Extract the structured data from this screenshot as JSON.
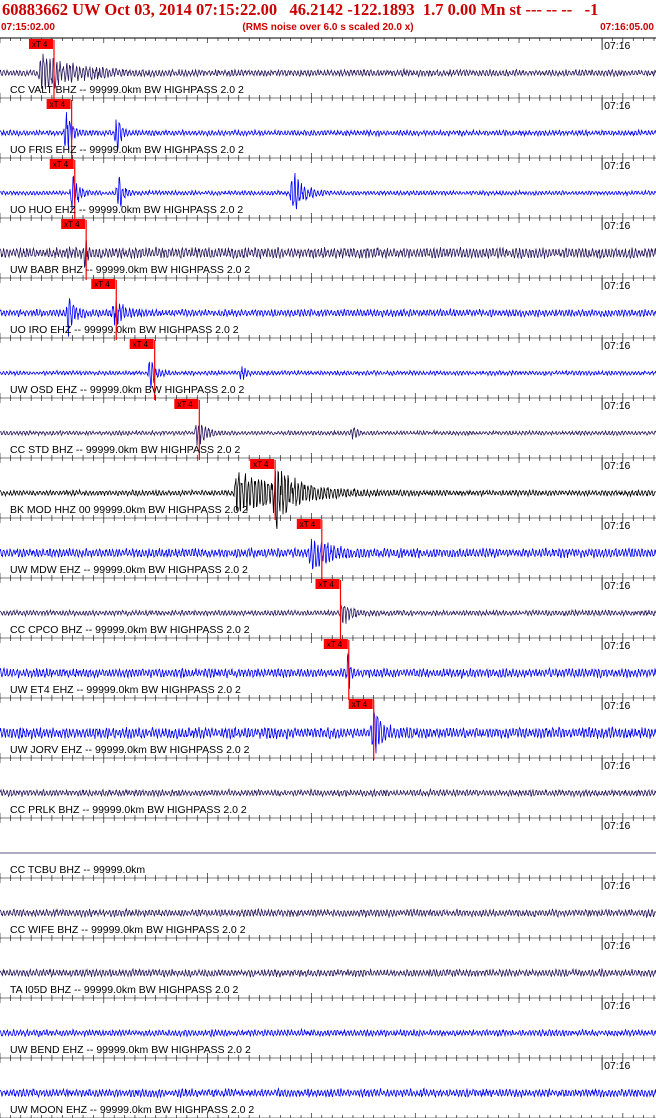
{
  "header": {
    "title": "60883662 UW Oct 03, 2014 07:15:22.00   46.2142 -122.1893  1.7 0.00 Mn st --- -- --   -1",
    "start_time": "07:15:02.00",
    "note": "(RMS noise over 6.0 s scaled 20.0 x)",
    "end_time": "07:16:05.00"
  },
  "chart_data": {
    "type": "line",
    "title": "60883662 UW Oct 03, 2014 07:15:22.00   46.2142 -122.1893  1.7 0.00 Mn st --- -- --   -1",
    "x_range_seconds": [
      0,
      63
    ],
    "minute_tick_label": "07:16",
    "minute_tick_seconds": 58,
    "pick_label": "xT 4",
    "colors": {
      "pick": "#ff0000",
      "grid": "#000000",
      "header": "#cc0000"
    },
    "traces": [
      {
        "label": "CC VALT BHZ -- 99999.0km BW  HIGHPASS  2.0  2",
        "color": "#2a1a5e",
        "pick_s": 5.2,
        "events": [
          {
            "t": 4.0,
            "dur": 9.0,
            "amp": 0.9
          }
        ],
        "noise": 0.18
      },
      {
        "label": "UO FRIS EHZ -- 99999.0km BW  HIGHPASS  2.0  2",
        "color": "#0000ff",
        "pick_s": 6.9,
        "events": [
          {
            "t": 6.4,
            "dur": 1.5,
            "amp": 1.0
          },
          {
            "t": 11.2,
            "dur": 1.2,
            "amp": 1.0
          }
        ],
        "noise": 0.15
      },
      {
        "label": "UO HUO EHZ -- 99999.0km BW  HIGHPASS  2.0  2",
        "color": "#0000ff",
        "pick_s": 7.2,
        "events": [
          {
            "t": 7.0,
            "dur": 1.5,
            "amp": 1.0
          },
          {
            "t": 11.4,
            "dur": 1.2,
            "amp": 1.0
          },
          {
            "t": 28.2,
            "dur": 2.5,
            "amp": 1.3
          }
        ],
        "noise": 0.12
      },
      {
        "label": "UW BABR BHZ -- 99999.0km BW  HIGHPASS  2.0  2",
        "color": "#2a1a5e",
        "pick_s": 8.3,
        "events": [
          {
            "t": 8.3,
            "dur": 0.4,
            "amp": 1.0
          }
        ],
        "noise": 0.3
      },
      {
        "label": "UO IRO EHZ -- 99999.0km BW  HIGHPASS  2.0  2",
        "color": "#0000ff",
        "pick_s": 11.2,
        "events": [
          {
            "t": 6.6,
            "dur": 1.6,
            "amp": 1.0
          },
          {
            "t": 11.1,
            "dur": 1.6,
            "amp": 1.0
          }
        ],
        "noise": 0.2
      },
      {
        "label": "UW OSD EHZ -- 99999.0km BW  HIGHPASS  2.0  2",
        "color": "#0000ff",
        "pick_s": 14.9,
        "events": [
          {
            "t": 14.5,
            "dur": 1.5,
            "amp": 0.9
          },
          {
            "t": 23.3,
            "dur": 1.0,
            "amp": 0.4
          }
        ],
        "noise": 0.12
      },
      {
        "label": "CC STD BHZ -- 99999.0km BW  HIGHPASS  2.0  2",
        "color": "#2a1a5e",
        "pick_s": 19.2,
        "events": [
          {
            "t": 19.0,
            "dur": 2.5,
            "amp": 0.6
          },
          {
            "t": 34.0,
            "dur": 1.2,
            "amp": 0.25
          }
        ],
        "noise": 0.12
      },
      {
        "label": "BK MOD HHZ 00 99999.0km BW  HIGHPASS  2.0  2",
        "color": "#000000",
        "pick_s": 26.5,
        "events": [
          {
            "t": 22.8,
            "dur": 12.0,
            "amp": 1.0
          },
          {
            "t": 26.5,
            "dur": 5.0,
            "amp": 1.3
          }
        ],
        "noise": 0.15
      },
      {
        "label": "UW MDW EHZ -- 99999.0km BW  HIGHPASS  2.0  2",
        "color": "#0000ff",
        "pick_s": 31.0,
        "events": [
          {
            "t": 30.0,
            "dur": 4.0,
            "amp": 0.9
          }
        ],
        "noise": 0.25
      },
      {
        "label": "CC CPCO BHZ -- 99999.0km BW  HIGHPASS  2.0  2",
        "color": "#2a1a5e",
        "pick_s": 32.8,
        "events": [
          {
            "t": 33.0,
            "dur": 2.0,
            "amp": 0.6
          }
        ],
        "noise": 0.15
      },
      {
        "label": "UW ET4 EHZ -- 99999.0km BW  HIGHPASS  2.0  2",
        "color": "#0000ff",
        "pick_s": 33.6,
        "events": [
          {
            "t": 33.6,
            "dur": 0.5,
            "amp": 1.0
          }
        ],
        "noise": 0.25
      },
      {
        "label": "UW JORV EHZ -- 99999.0km BW  HIGHPASS  2.0  2",
        "color": "#0000ff",
        "pick_s": 36.0,
        "events": [
          {
            "t": 36.0,
            "dur": 2.0,
            "amp": 1.2
          }
        ],
        "noise": 0.3
      },
      {
        "label": "CC PRLK BHZ -- 99999.0km BW  HIGHPASS  2.0  2",
        "color": "#2a1a5e",
        "pick_s": null,
        "events": [],
        "noise": 0.18
      },
      {
        "label": "CC TCBU BHZ -- 99999.0km",
        "color": "#2a1a5e",
        "pick_s": null,
        "events": [],
        "noise": 0.0
      },
      {
        "label": "CC WIFE BHZ -- 99999.0km BW  HIGHPASS  2.0  2",
        "color": "#2a1a5e",
        "pick_s": null,
        "events": [],
        "noise": 0.2
      },
      {
        "label": "TA I05D BHZ -- 99999.0km BW  HIGHPASS  2.0  2",
        "color": "#2a1a5e",
        "pick_s": null,
        "events": [],
        "noise": 0.2
      },
      {
        "label": "UW BEND EHZ -- 99999.0km BW  HIGHPASS  2.0  2",
        "color": "#0000ff",
        "pick_s": null,
        "events": [],
        "noise": 0.18
      },
      {
        "label": "UW MOON EHZ -- 99999.0km BW  HIGHPASS  2.0  2",
        "color": "#0000ff",
        "pick_s": null,
        "events": [],
        "noise": 0.22
      }
    ]
  }
}
